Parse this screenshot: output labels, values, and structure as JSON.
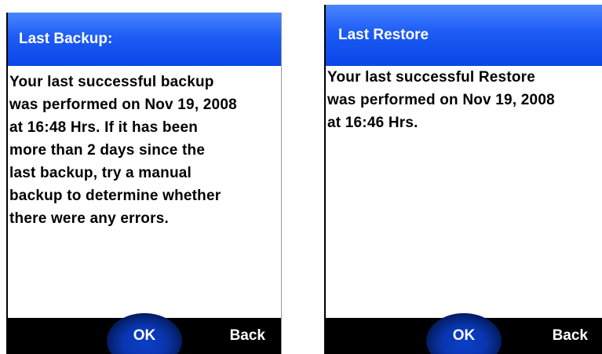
{
  "screens": [
    {
      "title": "Last Backup:",
      "message": "Your last successful backup\nwas performed on Nov 19, 2008\nat 16:48 Hrs. If it has been\nmore than 2 days since the\nlast backup, try a manual\nbackup to determine whether\nthere were any errors.",
      "softkeys": {
        "ok": "OK",
        "back": "Back"
      }
    },
    {
      "title": "Last Restore",
      "message": "Your last successful Restore\nwas performed on Nov 19, 2008\nat 16:46 Hrs.",
      "softkeys": {
        "ok": "OK",
        "back": "Back"
      }
    }
  ],
  "colors": {
    "title_bar": "#1d5cf5",
    "softkey_bar": "#000000",
    "ok_glow": "#0b3fc8"
  }
}
